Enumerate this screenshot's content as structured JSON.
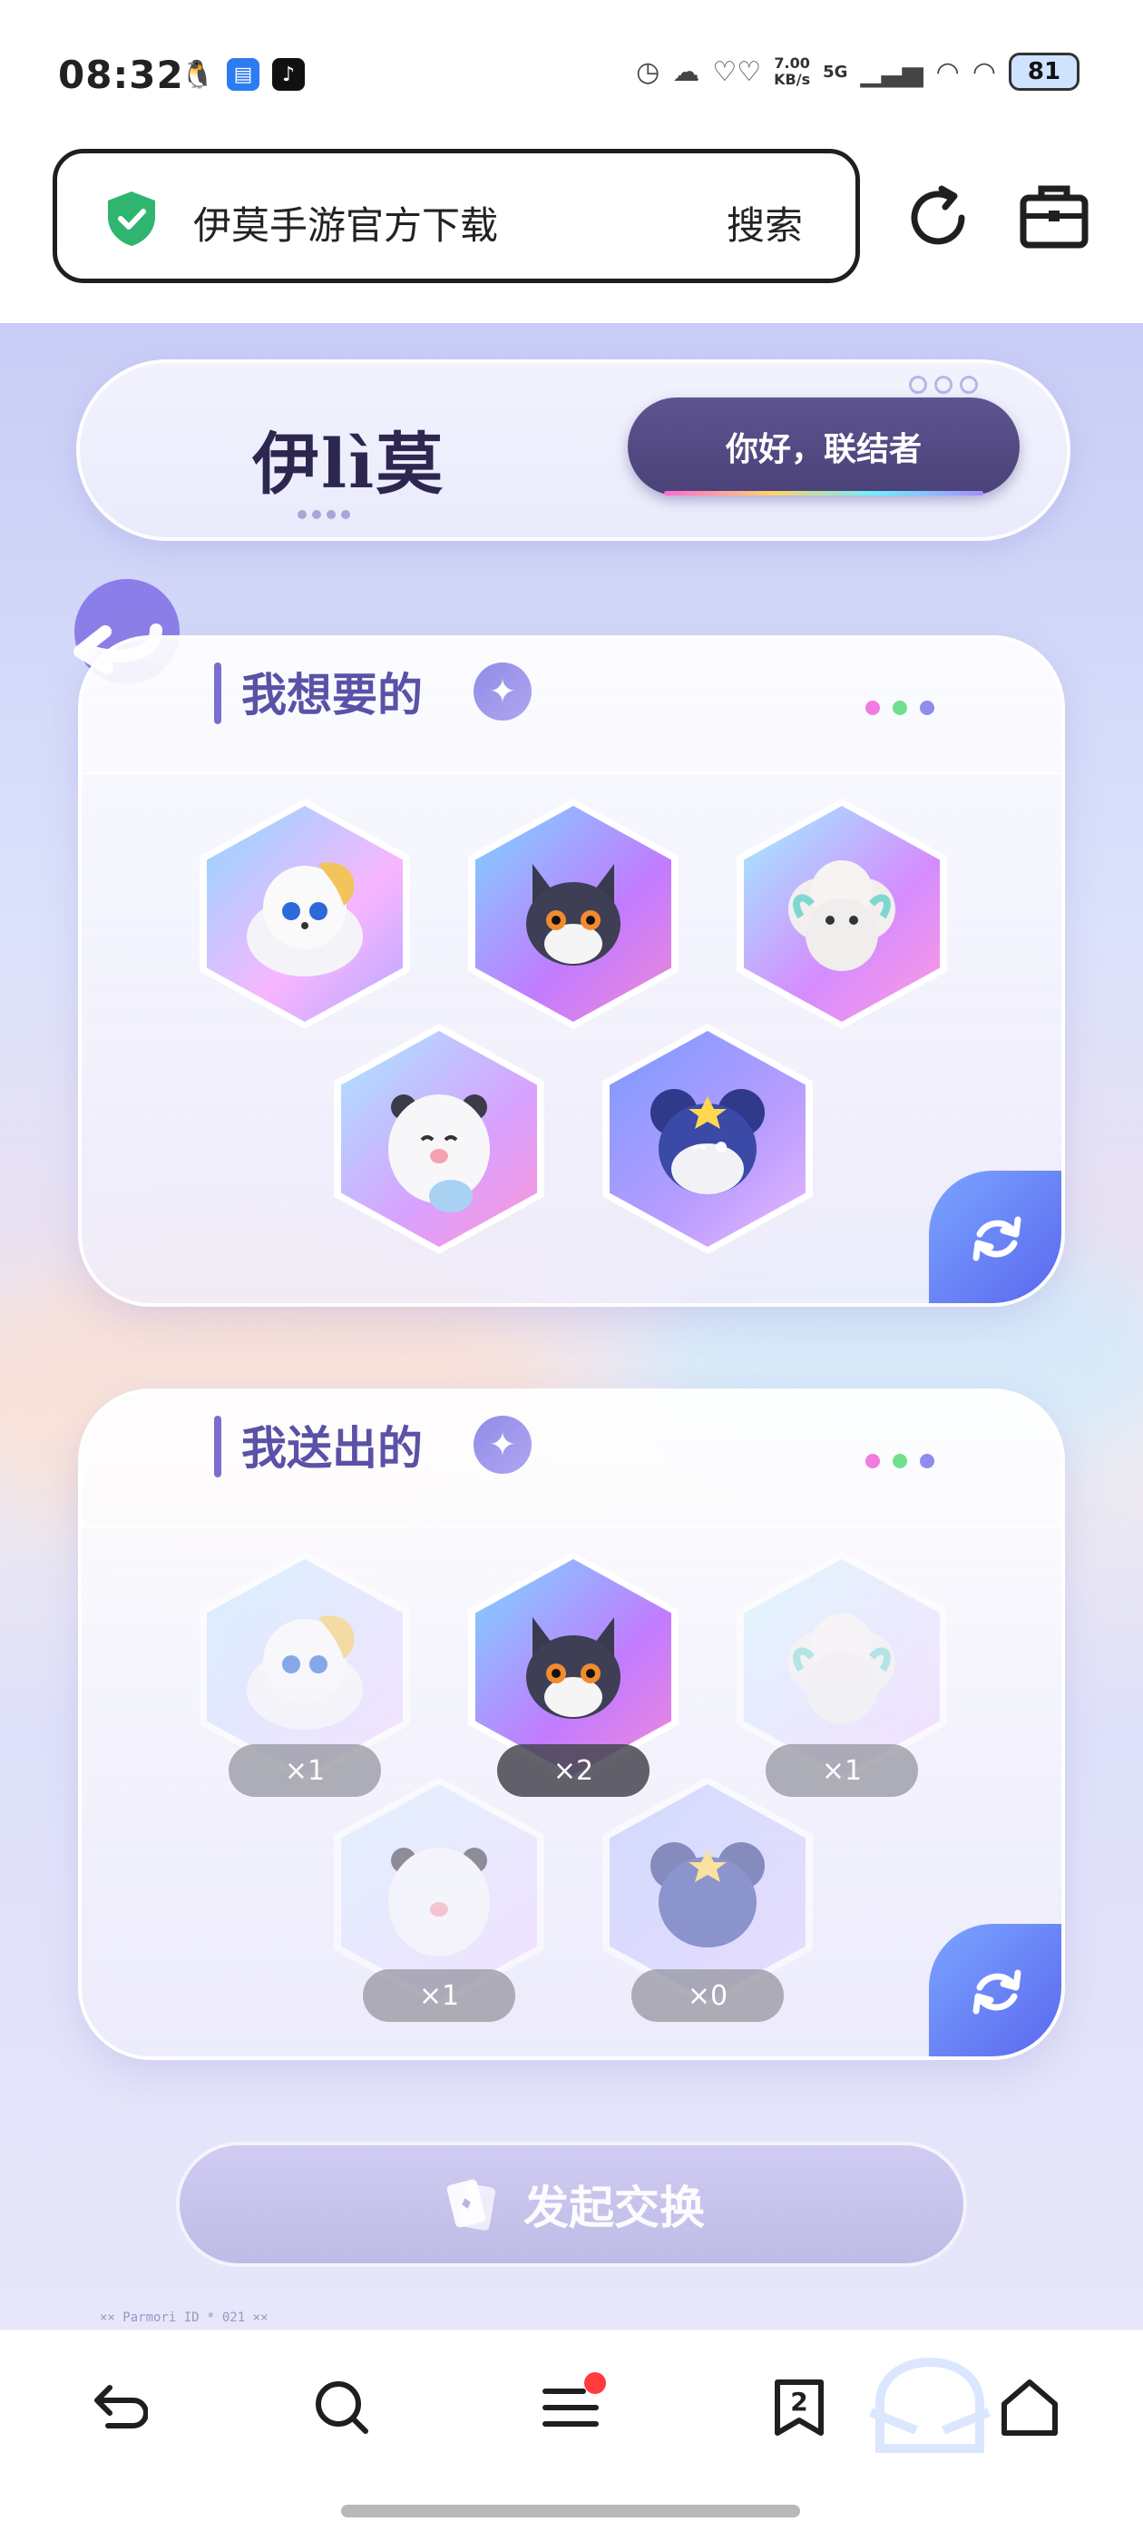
{
  "status_bar": {
    "time": "08:32",
    "net_speed_value": "7.00",
    "net_speed_unit": "KB/s",
    "network": "5G",
    "battery": "81"
  },
  "address_bar": {
    "query": "伊莫手游官方下载",
    "search_label": "搜索"
  },
  "page": {
    "logo_text": "伊lì莫",
    "greeting": "你好，联结者",
    "want_section": {
      "title": "我想要的"
    },
    "give_section": {
      "title": "我送出的",
      "counts": [
        "×1",
        "×2",
        "×1",
        "×1",
        "×0"
      ]
    },
    "launch_button": "发起交换",
    "footer_text": "×× Parmori ID * 021 ××"
  },
  "bottom_nav": {
    "tab_count": "2"
  },
  "colors": {
    "accent": "#5a52a6",
    "greeting_bg": "#4f4680",
    "refresh_corner": "#5a66ee",
    "notif_red": "#ff3b3b"
  }
}
